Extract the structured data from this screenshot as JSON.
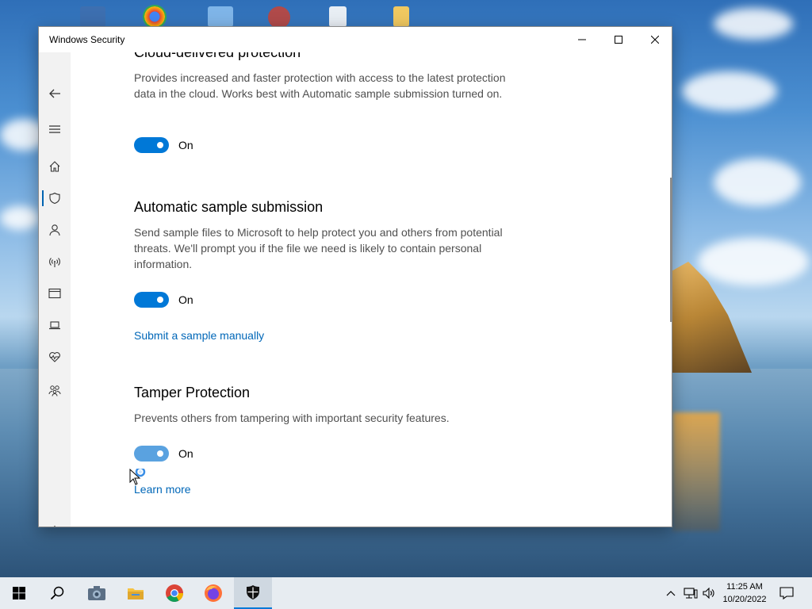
{
  "window": {
    "title": "Windows Security",
    "controls": {
      "minimize": "minimize-icon",
      "maximize": "maximize-icon",
      "close": "close-icon"
    }
  },
  "sidebar": {
    "items": [
      {
        "icon": "back-arrow-icon"
      },
      {
        "icon": "hamburger-menu-icon"
      },
      {
        "icon": "home-icon"
      },
      {
        "icon": "shield-icon",
        "active": true
      },
      {
        "icon": "person-icon"
      },
      {
        "icon": "wifi-antenna-icon"
      },
      {
        "icon": "browser-window-icon"
      },
      {
        "icon": "laptop-icon"
      },
      {
        "icon": "heart-health-icon"
      },
      {
        "icon": "family-icon"
      },
      {
        "icon": "gear-icon"
      }
    ]
  },
  "sections": {
    "cloud": {
      "title": "Cloud-delivered protection",
      "description": "Provides increased and faster protection with access to the latest protection data in the cloud. Works best with Automatic sample submission turned on.",
      "toggle_label": "On"
    },
    "sample": {
      "title": "Automatic sample submission",
      "description": "Send sample files to Microsoft to help protect you and others from potential threats. We'll prompt you if the file we need is likely to contain personal information.",
      "toggle_label": "On",
      "link": "Submit a sample manually"
    },
    "tamper": {
      "title": "Tamper Protection",
      "description": "Prevents others from tampering with important security features.",
      "toggle_label": "On",
      "link": "Learn more"
    }
  },
  "taskbar": {
    "apps": [
      "start-icon",
      "search-icon",
      "camera-app-icon",
      "file-explorer-icon",
      "chrome-icon",
      "firefox-icon",
      "windows-security-icon"
    ],
    "clock_time": "11:25 AM",
    "clock_date": "10/20/2022"
  },
  "colors": {
    "accent": "#0078d7",
    "link": "#0067b8",
    "sidebar_bg": "#f2f2f2"
  }
}
